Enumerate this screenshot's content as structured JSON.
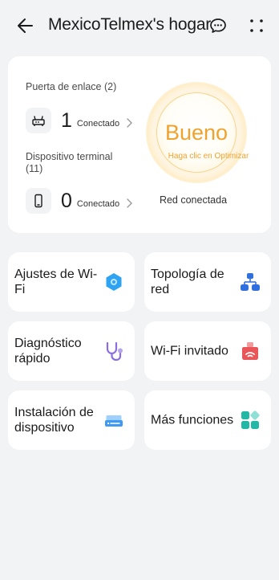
{
  "header": {
    "title": "MexicoTelmex's hogar",
    "back_icon": "arrow-left-icon",
    "chat_icon": "chat-bubble-icon",
    "more_icon": "more-dots-icon"
  },
  "status": {
    "gateway_label": "Puerta de enlace (2)",
    "gateway_count": "1",
    "gateway_status": "Conectado",
    "terminal_label": "Dispositivo terminal (11)",
    "terminal_count": "0",
    "terminal_status": "Conectado",
    "quality": "Bueno",
    "quality_hint": "Haga clic en Optimizar",
    "network_status": "Red conectada"
  },
  "tiles": [
    {
      "label": "Ajustes de Wi-Fi",
      "icon": "wifi-settings-icon"
    },
    {
      "label": "Topología de red",
      "icon": "topology-icon"
    },
    {
      "label": "Diagnóstico rápido",
      "icon": "stethoscope-icon"
    },
    {
      "label": "Wi-Fi invitado",
      "icon": "guest-wifi-icon"
    },
    {
      "label": "Instalación de dispositivo",
      "icon": "device-install-icon"
    },
    {
      "label": "Más funciones",
      "icon": "more-functions-icon"
    }
  ],
  "colors": {
    "accent_orange": "#f0a22e",
    "blue": "#2ea3f2",
    "purple": "#8a6ee0",
    "red": "#e8565a",
    "teal": "#22b8a5"
  }
}
